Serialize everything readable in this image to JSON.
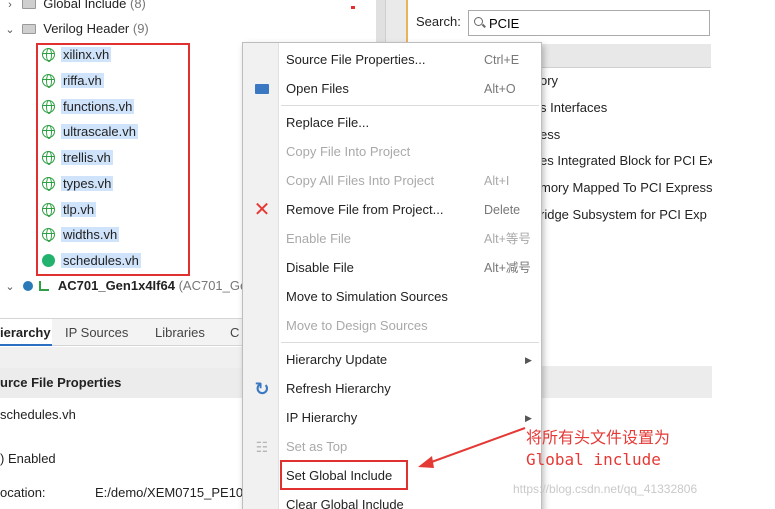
{
  "tree": {
    "global_include": {
      "label": "Global Include",
      "count": "(8)"
    },
    "verilog_header": {
      "label": "Verilog Header",
      "count": "(9)"
    },
    "files": [
      "xilinx.vh",
      "riffa.vh",
      "functions.vh",
      "ultrascale.vh",
      "trellis.vh",
      "types.vh",
      "tlp.vh",
      "widths.vh",
      "schedules.vh"
    ],
    "top_module": {
      "label": "AC701_Gen1x4If64",
      "suffix": "(AC701_Ge"
    }
  },
  "tabs": [
    "ierarchy",
    "IP Sources",
    "Libraries",
    "C"
  ],
  "properties": {
    "header": "urce File Properties",
    "file": "schedules.vh",
    "enabled": ") Enabled",
    "location_label": "ocation:",
    "location_value": "E:/demo/XEM0715_PE10"
  },
  "search": {
    "label": "Search:",
    "value": "PCIE"
  },
  "results": [
    "ory",
    "s Interfaces",
    "ess",
    "es Integrated Block for PCI Ex",
    "mory Mapped To PCI Express",
    "ridge Subsystem for PCI Exp"
  ],
  "menu": {
    "items": [
      {
        "label": "Source File Properties...",
        "shortcut": "Ctrl+E",
        "disabled": false
      },
      {
        "label": "Open Files",
        "shortcut": "Alt+O",
        "disabled": false
      },
      {
        "label": "Replace File...",
        "shortcut": "",
        "disabled": false
      },
      {
        "label": "Copy File Into Project",
        "shortcut": "",
        "disabled": true
      },
      {
        "label": "Copy All Files Into Project",
        "shortcut": "Alt+I",
        "disabled": true
      },
      {
        "label": "Remove File from Project...",
        "shortcut": "Delete",
        "disabled": false
      },
      {
        "label": "Enable File",
        "shortcut": "Alt+等号",
        "disabled": true
      },
      {
        "label": "Disable File",
        "shortcut": "Alt+减号",
        "disabled": false
      },
      {
        "label": "Move to Simulation Sources",
        "shortcut": "",
        "disabled": false
      },
      {
        "label": "Move to Design Sources",
        "shortcut": "",
        "disabled": true
      },
      {
        "label": "Hierarchy Update",
        "shortcut": "",
        "disabled": false
      },
      {
        "label": "Refresh Hierarchy",
        "shortcut": "",
        "disabled": false
      },
      {
        "label": "IP Hierarchy",
        "shortcut": "",
        "disabled": false
      },
      {
        "label": "Set as Top",
        "shortcut": "",
        "disabled": true
      },
      {
        "label": "Set Global Include",
        "shortcut": "",
        "disabled": false
      },
      {
        "label": "Clear Global Include",
        "shortcut": "",
        "disabled": false
      }
    ]
  },
  "annotation": {
    "line1": "将所有头文件设置为",
    "line2": "Global include"
  },
  "watermark": "https://blog.csdn.net/qq_41332806",
  "colors": {
    "annotation_red": "#e53935",
    "selection_blue": "#cfe3fb",
    "accent_blue": "#2b6fc2",
    "file_icon_green": "#2ea043"
  },
  "icons": {
    "open_files": "folder-open-icon",
    "remove_file": "red-x-icon",
    "refresh_hierarchy": "refresh-icon",
    "set_as_top": "hierarchy-icon"
  }
}
